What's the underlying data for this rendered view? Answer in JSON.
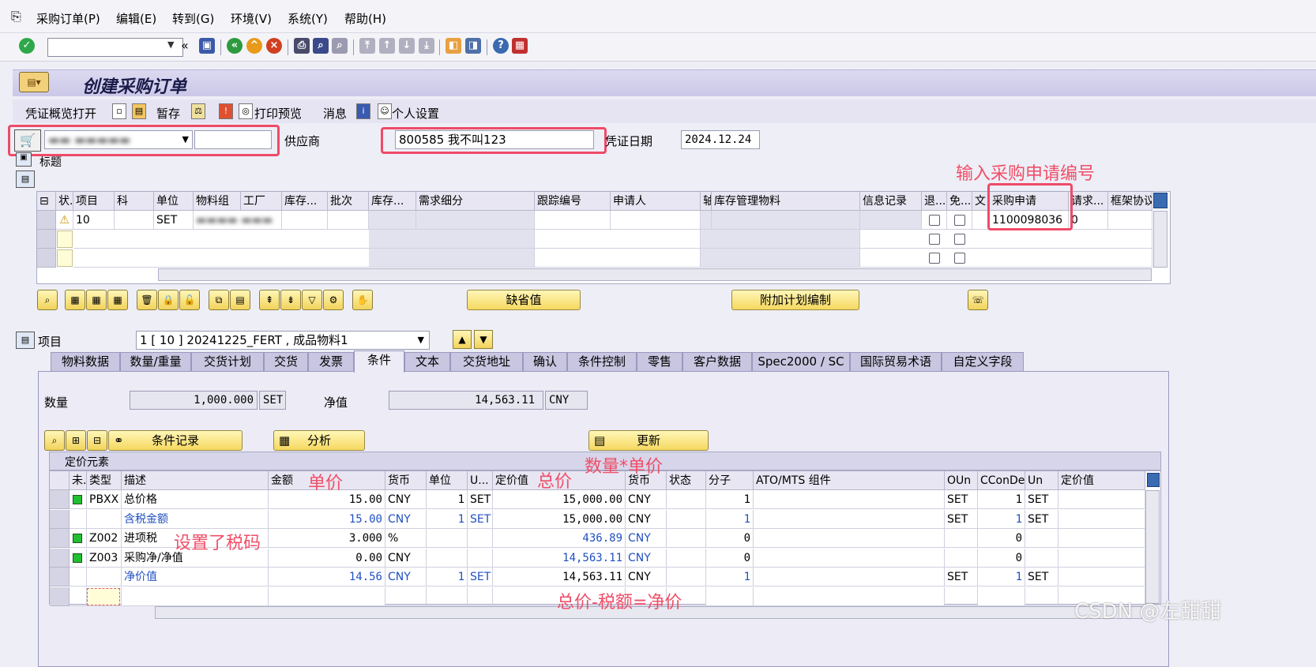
{
  "menu": [
    {
      "label": "采购订单(P)"
    },
    {
      "label": "编辑(E)"
    },
    {
      "label": "转到(G)"
    },
    {
      "label": "环境(V)"
    },
    {
      "label": "系统(Y)"
    },
    {
      "label": "帮助(H)"
    }
  ],
  "title": "创建采购订单",
  "app_toolbar": {
    "overview": "凭证概览打开",
    "hold": "暂存",
    "print_preview": "打印预览",
    "messages": "消息",
    "personal_settings": "个人设置"
  },
  "header": {
    "vendor_label": "供应商",
    "vendor_value": "800585 我不叫123",
    "doc_date_label": "凭证日期",
    "doc_date_value": "2024.12.24",
    "header_label": "标题"
  },
  "annotations": {
    "enter_pr": "输入采购申请编号",
    "unit_price": "单价",
    "total_price": "总价",
    "qty_times_price": "数量*单价",
    "tax_code_set": "设置了税码",
    "net_formula": "总价-税额=净价"
  },
  "item_grid": {
    "columns": [
      "状.",
      "项目",
      "科",
      "单位",
      "物料组",
      "工厂",
      "库存...",
      "批次",
      "库存...",
      "需求细分",
      "跟踪编号",
      "申请人",
      "轴",
      "库存管理物料",
      "信息记录",
      "退...",
      "免...",
      "文",
      "采购申请",
      "请求...",
      "框架协议"
    ],
    "row": {
      "item": "10",
      "unit": "SET",
      "pr_number": "1100098036",
      "pr_item": "0"
    }
  },
  "buttons": {
    "defaults": "缺省值",
    "additional_planning": "附加计划编制",
    "condition_record": "条件记录",
    "analysis": "分析",
    "update": "更新"
  },
  "item_detail": {
    "label": "项目",
    "selected": "1 [ 10 ] 20241225_FERT , 成品物料1"
  },
  "tabs": [
    "物料数据",
    "数量/重量",
    "交货计划",
    "交货",
    "发票",
    "条件",
    "文本",
    "交货地址",
    "确认",
    "条件控制",
    "零售",
    "客户数据",
    "Spec2000 / SC",
    "国际贸易术语",
    "自定义字段"
  ],
  "conditions": {
    "qty_label": "数量",
    "qty_value": "1,000.000",
    "qty_unit": "SET",
    "net_label": "净值",
    "net_value": "14,563.11",
    "net_currency": "CNY",
    "pricing_title": "定价元素",
    "columns": [
      "未.",
      "类型",
      "描述",
      "金额",
      "货币",
      "单位",
      "U...",
      "定价值",
      "货币",
      "状态",
      "分子",
      "ATO/MTS 组件",
      "OUn",
      "CConDe",
      "Un",
      "定价值"
    ],
    "rows": [
      {
        "status": "green",
        "type": "PBXX",
        "desc": "总价格",
        "amount": "15.00",
        "curr": "CNY",
        "per": "1",
        "uom": "SET",
        "cond_value": "15,000.00",
        "curr2": "CNY",
        "numer": "1",
        "oun": "SET",
        "ccon": "1",
        "un": "SET",
        "blue": false
      },
      {
        "status": "",
        "type": "",
        "desc": "含税金额",
        "amount": "15.00",
        "curr": "CNY",
        "per": "1",
        "uom": "SET",
        "cond_value": "15,000.00",
        "curr2": "CNY",
        "numer": "1",
        "oun": "SET",
        "ccon": "1",
        "un": "SET",
        "blue": true
      },
      {
        "status": "green",
        "type": "Z002",
        "desc": "进项税",
        "amount": "3.000",
        "curr": "%",
        "per": "",
        "uom": "",
        "cond_value": "436.89",
        "curr2": "CNY",
        "numer": "0",
        "oun": "",
        "ccon": "0",
        "un": "",
        "blue": false
      },
      {
        "status": "green",
        "type": "Z003",
        "desc": "采购净/净值",
        "amount": "0.00",
        "curr": "CNY",
        "per": "",
        "uom": "",
        "cond_value": "14,563.11",
        "curr2": "CNY",
        "numer": "0",
        "oun": "",
        "ccon": "0",
        "un": "",
        "blue": false
      },
      {
        "status": "",
        "type": "",
        "desc": "净价值",
        "amount": "14.56",
        "curr": "CNY",
        "per": "1",
        "uom": "SET",
        "cond_value": "14,563.11",
        "curr2": "CNY",
        "numer": "1",
        "oun": "SET",
        "ccon": "1",
        "un": "SET",
        "blue": true
      }
    ]
  },
  "watermark": "CSDN @左甜甜"
}
